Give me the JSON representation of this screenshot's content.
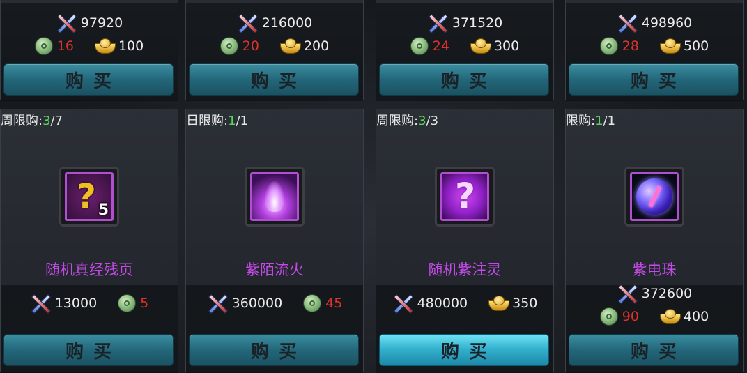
{
  "top_cards": [
    {
      "power": "97920",
      "jade": "16",
      "gold": "100",
      "buy_label": "购买"
    },
    {
      "power": "216000",
      "jade": "20",
      "gold": "200",
      "buy_label": "购买"
    },
    {
      "power": "371520",
      "jade": "24",
      "gold": "300",
      "buy_label": "购买"
    },
    {
      "power": "498960",
      "jade": "28",
      "gold": "500",
      "buy_label": "购买"
    }
  ],
  "bottom_cards": [
    {
      "limit_label": "周限购:",
      "limit_current": "3",
      "limit_total": "/7",
      "item_name": "随机真经残页",
      "quantity": "5",
      "power": "13000",
      "jade": "5",
      "buy_label": "购买",
      "icon": "purple-scroll-question-icon"
    },
    {
      "limit_label": "日限购:",
      "limit_current": "1",
      "limit_total": "/1",
      "item_name": "紫陌流火",
      "power": "360000",
      "jade": "45",
      "buy_label": "购买",
      "icon": "purple-flame-icon"
    },
    {
      "limit_label": "周限购:",
      "limit_current": "3",
      "limit_total": "/3",
      "item_name": "随机紫注灵",
      "power": "480000",
      "gold": "350",
      "buy_label": "购买",
      "icon": "purple-question-mark-icon"
    },
    {
      "limit_label": "限购:",
      "limit_current": "1",
      "limit_total": "/1",
      "item_name": "紫电珠",
      "power": "372600",
      "jade": "90",
      "gold": "400",
      "buy_label": "购买",
      "icon": "purple-lightning-orb-icon"
    }
  ],
  "colors": {
    "item_name": "#c34ae8",
    "limit_current": "#5ad35a",
    "jade_cost": "#e0312b",
    "button": "#23677a"
  }
}
